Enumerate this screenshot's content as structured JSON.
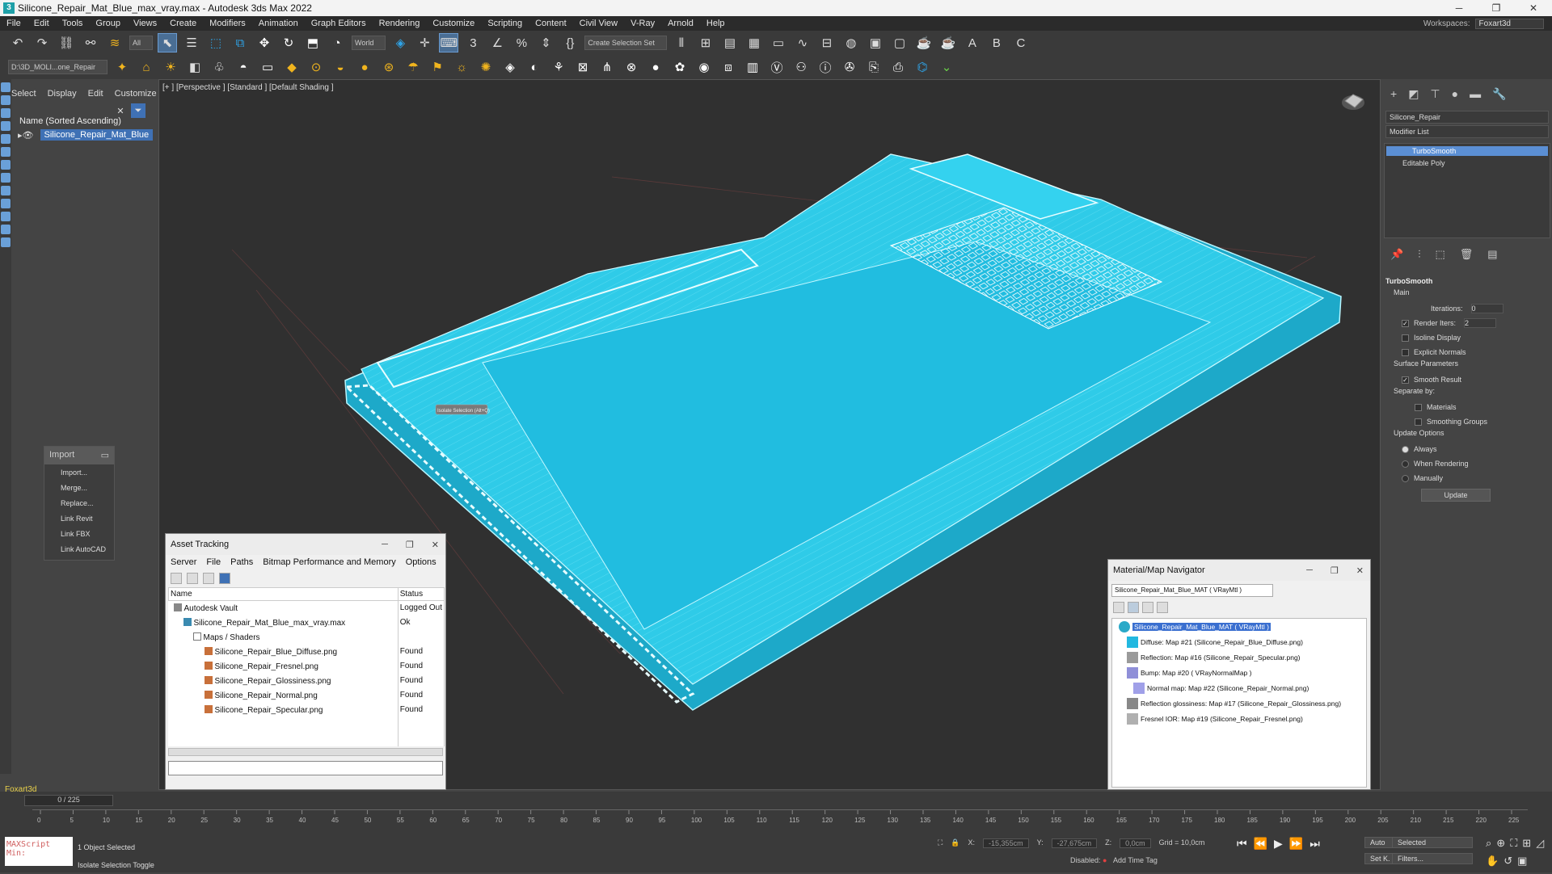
{
  "window": {
    "title": "Silicone_Repair_Mat_Blue_max_vray.max - Autodesk 3ds Max 2022",
    "app_glyph": "3",
    "min": "─",
    "max": "❐",
    "close": "✕"
  },
  "menu": [
    "File",
    "Edit",
    "Tools",
    "Group",
    "Views",
    "Create",
    "Modifiers",
    "Animation",
    "Graph Editors",
    "Rendering",
    "Customize",
    "Scripting",
    "Content",
    "Civil View",
    "V-Ray",
    "Arnold",
    "Help"
  ],
  "workspace": {
    "label": "Workspaces:",
    "value": "Foxart3d"
  },
  "toolbar": {
    "filter": "All",
    "coord": "World",
    "selset": "Create Selection Set",
    "project": "D:\\3D_MOLI...one_Repair"
  },
  "scene_explorer": {
    "tabs": [
      "Select",
      "Display",
      "Edit",
      "Customize"
    ],
    "sort_label": "Name (Sorted Ascending)",
    "object": "Silicone_Repair_Mat_Blue",
    "layer": "Foxart3d"
  },
  "import_menu": {
    "title": "Import",
    "items": [
      "Import...",
      "Merge...",
      "Replace...",
      "Link Revit",
      "Link FBX",
      "Link AutoCAD"
    ]
  },
  "viewport": {
    "label": "[+ ] [Perspective ] [Standard ] [Default Shading ]",
    "tooltip": "Isolate Selection  (Alt+Q)"
  },
  "command_panel": {
    "object_name": "Silicone_Repair",
    "modifier_list": "Modifier List",
    "stack": [
      "TurboSmooth",
      "Editable Poly"
    ],
    "turbosmooth": {
      "title": "TurboSmooth",
      "main": "Main",
      "iterations_label": "Iterations:",
      "iterations": "0",
      "render_iters_label": "Render Iters:",
      "render_iters": "2",
      "isoline": "Isoline Display",
      "explicit": "Explicit Normals",
      "surface": "Surface Parameters",
      "smooth_result": "Smooth Result",
      "separate": "Separate by:",
      "materials": "Materials",
      "smoothing": "Smoothing Groups",
      "update_opts": "Update Options",
      "always": "Always",
      "when_rendering": "When Rendering",
      "manually": "Manually",
      "update_btn": "Update"
    }
  },
  "asset_tracking": {
    "title": "Asset Tracking",
    "menu": [
      "Server",
      "File",
      "Paths",
      "Bitmap Performance and Memory",
      "Options"
    ],
    "headers": [
      "Name",
      "Status"
    ],
    "rows": [
      {
        "name": "Autodesk Vault",
        "status": "Logged Out",
        "indent": 0
      },
      {
        "name": "Silicone_Repair_Mat_Blue_max_vray.max",
        "status": "Ok",
        "indent": 1
      },
      {
        "name": "Maps / Shaders",
        "status": "",
        "indent": 2
      },
      {
        "name": "Silicone_Repair_Blue_Diffuse.png",
        "status": "Found",
        "indent": 3
      },
      {
        "name": "Silicone_Repair_Fresnel.png",
        "status": "Found",
        "indent": 3
      },
      {
        "name": "Silicone_Repair_Glossiness.png",
        "status": "Found",
        "indent": 3
      },
      {
        "name": "Silicone_Repair_Normal.png",
        "status": "Found",
        "indent": 3
      },
      {
        "name": "Silicone_Repair_Specular.png",
        "status": "Found",
        "indent": 3
      }
    ]
  },
  "material_navigator": {
    "title": "Material/Map Navigator",
    "name_field": "Silicone_Repair_Mat_Blue_MAT  ( VRayMtl )",
    "nodes": [
      {
        "label": "Silicone_Repair_Mat_Blue_MAT  ( VRayMtl )",
        "color": "#2aa9c8",
        "root": true
      },
      {
        "label": "Diffuse: Map #21 (Silicone_Repair_Blue_Diffuse.png)",
        "color": "#22b8e0"
      },
      {
        "label": "Reflection: Map #16 (Silicone_Repair_Specular.png)",
        "color": "#9a9a9a"
      },
      {
        "label": "Bump: Map #20  ( VRayNormalMap )",
        "color": "#8f8fd8"
      },
      {
        "label": "Normal map: Map #22 (Silicone_Repair_Normal.png)",
        "color": "#a0a0e8"
      },
      {
        "label": "Reflection glossiness: Map #17 (Silicone_Repair_Glossiness.png)",
        "color": "#888888"
      },
      {
        "label": "Fresnel IOR: Map #19 (Silicone_Repair_Fresnel.png)",
        "color": "#b0b0b0"
      }
    ]
  },
  "timeline": {
    "frame": "0 / 225",
    "ticks": [
      "0",
      "5",
      "10",
      "15",
      "20",
      "25",
      "30",
      "35",
      "40",
      "45",
      "50",
      "55",
      "60",
      "65",
      "70",
      "75",
      "80",
      "85",
      "90",
      "95",
      "100",
      "105",
      "110",
      "115",
      "120",
      "125",
      "130",
      "135",
      "140",
      "145",
      "150",
      "155",
      "160",
      "165",
      "170",
      "175",
      "180",
      "185",
      "190",
      "195",
      "200",
      "205",
      "210",
      "215",
      "220",
      "225"
    ]
  },
  "status": {
    "selected": "1 Object Selected",
    "hint": "Isolate Selection Toggle",
    "maxscript": "MAXScript Min:",
    "x_label": "X:",
    "x": "-15,355cm",
    "y_label": "Y:",
    "y": "-27,675cm",
    "z_label": "Z:",
    "z": "0,0cm",
    "grid": "Grid = 10,0cm",
    "disabled": "Disabled:",
    "add_time_tag": "Add Time Tag",
    "auto": "Auto",
    "setk": "Set K.",
    "selected_drop": "Selected",
    "filters": "Filters..."
  },
  "colors": {
    "mesh": "#29c6e8",
    "wire": "#9ff3ff",
    "bg": "#303030",
    "select": "#3f71b5"
  }
}
